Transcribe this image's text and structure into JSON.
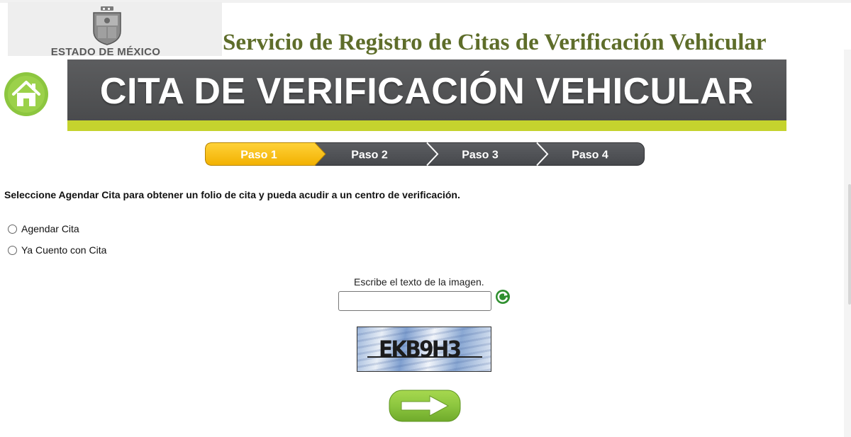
{
  "header": {
    "logo_text": "ESTADO DE MÉXICO",
    "site_title": "Servicio de Registro de Citas de Verificación Vehicular"
  },
  "banner": {
    "title": "CITA DE VERIFICACIÓN VEHICULAR"
  },
  "steps": [
    {
      "label": "Paso 1",
      "active": true
    },
    {
      "label": "Paso 2",
      "active": false
    },
    {
      "label": "Paso 3",
      "active": false
    },
    {
      "label": "Paso 4",
      "active": false
    }
  ],
  "form": {
    "instruction": "Seleccione Agendar Cita para obtener un folio de cita y pueda acudir a un centro de verificación.",
    "options": [
      {
        "label": "Agendar Cita",
        "checked": false
      },
      {
        "label": "Ya Cuento con Cita",
        "checked": false
      }
    ],
    "captcha_prompt": "Escribe el texto de la imagen.",
    "captcha_value": "",
    "captcha_image_text": "EKB9H3"
  },
  "icons": {
    "home": "home-icon",
    "refresh": "refresh-icon",
    "next": "arrow-right-icon"
  },
  "colors": {
    "accent_green": "#8cc63f",
    "title_olive": "#5e6d2a",
    "banner_gray": "#555658",
    "banner_lime": "#c5d32e",
    "step_active": "#ffc20e",
    "step_inactive": "#4f5155"
  }
}
